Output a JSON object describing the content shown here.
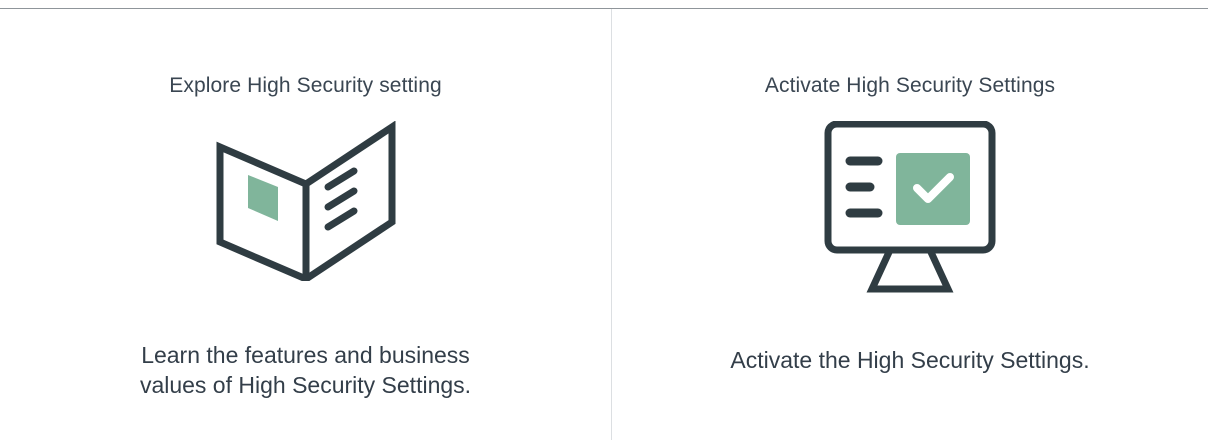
{
  "cards": [
    {
      "title": "Explore High Security setting",
      "icon": "open-book-icon",
      "description_lines": [
        "Learn the features and business",
        "values of High Security Settings."
      ]
    },
    {
      "title": "Activate High Security Settings",
      "icon": "monitor-checkmark-icon",
      "description_lines": [
        "Activate the High Security Settings."
      ]
    }
  ],
  "colors": {
    "icon_stroke": "#2f3c42",
    "icon_accent": "#80b59b",
    "text": "#3a4652",
    "divider": "#dcdfe2",
    "top_rule": "#8f959a"
  }
}
